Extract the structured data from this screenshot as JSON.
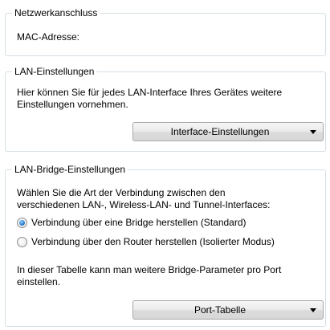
{
  "network": {
    "title": "Netzwerkanschluss",
    "mac_label": "MAC-Adresse:"
  },
  "lan": {
    "title": "LAN-Einstellungen",
    "description_line1": "Hier können Sie für jedes LAN-Interface Ihres Gerätes weitere",
    "description_line2": "Einstellungen vornehmen.",
    "button_label": "Interface-Einstellungen"
  },
  "bridge": {
    "title": "LAN-Bridge-Einstellungen",
    "description_line1": "Wählen Sie die Art der Verbindung zwischen den",
    "description_line2": "verschiedenen LAN-, Wireless-LAN- und Tunnel-Interfaces:",
    "options": [
      {
        "label": "Verbindung über eine Bridge herstellen (Standard)",
        "selected": true
      },
      {
        "label": "Verbindung über den Router herstellen (Isolierter Modus)",
        "selected": false
      }
    ],
    "table_note_line1": "In dieser Tabelle kann man weitere Bridge-Parameter pro Port",
    "table_note_line2": "einstellen.",
    "button_label": "Port-Tabelle"
  }
}
